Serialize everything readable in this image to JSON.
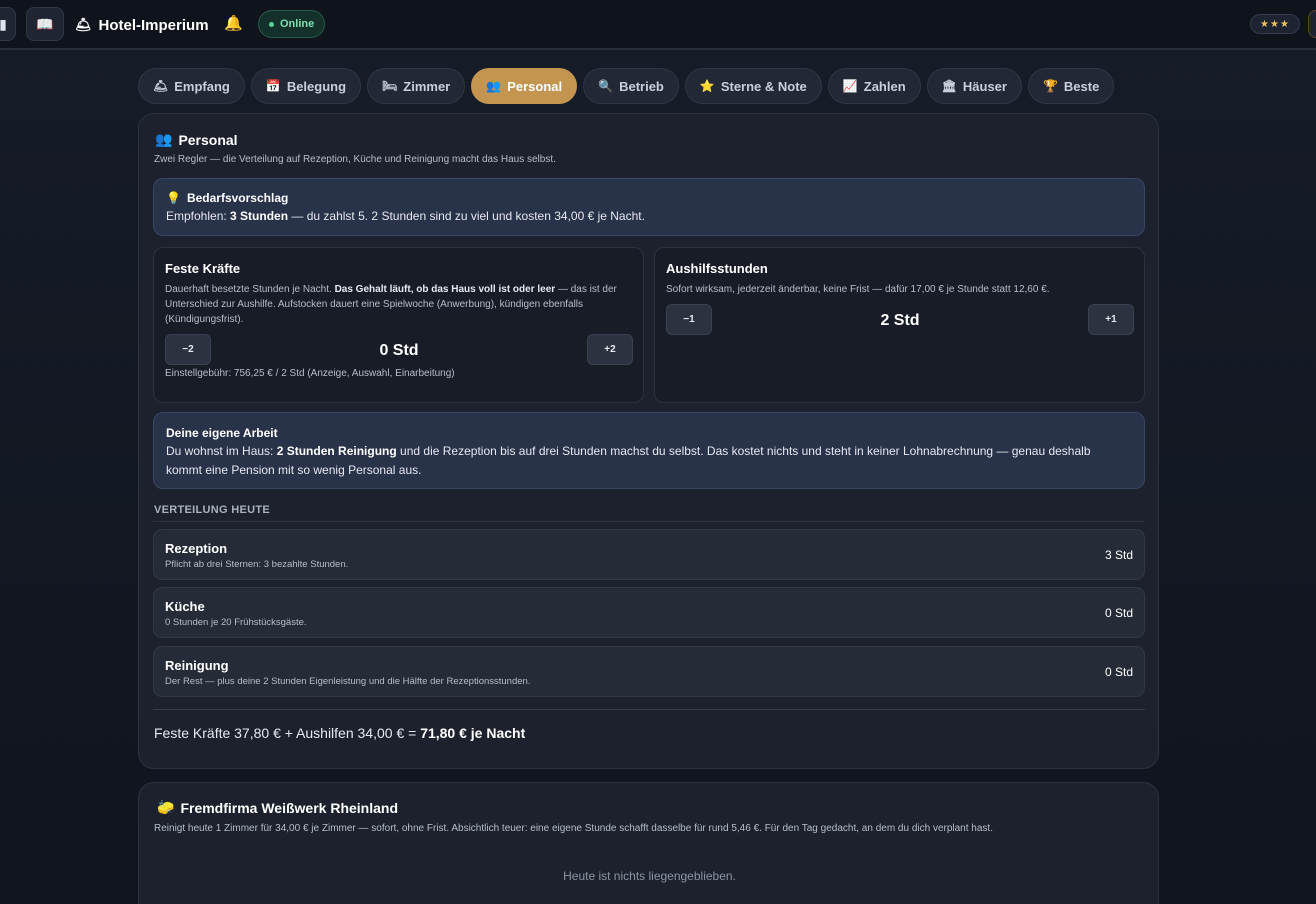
{
  "app": {
    "title": "Hotel-Imperium",
    "status": "Online",
    "stars": "★★★",
    "icons": {
      "brand": "bell-icon",
      "book": "book-icon",
      "ring": "bell-ring-icon"
    }
  },
  "tabs": [
    {
      "icon": "🛎",
      "label": "Empfang",
      "active": false
    },
    {
      "icon": "📅",
      "label": "Belegung",
      "active": false
    },
    {
      "icon": "🛏",
      "label": "Zimmer",
      "active": false
    },
    {
      "icon": "👥",
      "label": "Personal",
      "active": true
    },
    {
      "icon": "🔍",
      "label": "Betrieb",
      "active": false
    },
    {
      "icon": "⭐",
      "label": "Sterne & Note",
      "active": false
    },
    {
      "icon": "📈",
      "label": "Zahlen",
      "active": false
    },
    {
      "icon": "🏛",
      "label": "Häuser",
      "active": false
    },
    {
      "icon": "🏆",
      "label": "Beste",
      "active": false
    }
  ],
  "personal": {
    "icon": "👥",
    "title": "Personal",
    "subtitle": "Zwei Regler — die Verteilung auf Rezeption, Küche und Reinigung macht das Haus selbst.",
    "hint": {
      "icon": "💡",
      "title": "Bedarfsvorschlag",
      "prefix": "Empfohlen: ",
      "strong": "3 Stunden",
      "suffix": " — du zahlst 5. 2 Stunden sind zu viel und kosten 34,00 € je Nacht."
    },
    "fixed": {
      "title": "Feste Kräfte",
      "desc_a": "Dauerhaft besetzte Stunden je Nacht. ",
      "desc_b": "Das Gehalt läuft, ob das Haus voll ist oder leer",
      "desc_c": " — das ist der Unterschied zur Aushilfe. Aufstocken dauert eine Spielwoche (Anwerbung), kündigen ebenfalls (Kündigungsfrist).",
      "minus": "−2",
      "value": "0 Std",
      "plus": "+2",
      "fee": "Einstellgebühr: 756,25 € / 2 Std (Anzeige, Auswahl, Einarbeitung)"
    },
    "temp": {
      "title": "Aushilfsstunden",
      "desc": "Sofort wirksam, jederzeit änderbar, keine Frist — dafür 17,00 € je Stunde statt 12,60 €.",
      "minus": "−1",
      "value": "2 Std",
      "plus": "+1"
    },
    "own": {
      "title": "Deine eigene Arbeit",
      "prefix": "Du wohnst im Haus: ",
      "strong": "2 Stunden Reinigung",
      "suffix": " und die Rezeption bis auf drei Stunden machst du selbst. Das kostet nichts und steht in keiner Lohnabrechnung — genau deshalb kommt eine Pension mit so wenig Personal aus."
    },
    "distribution_heading": "VERTEILUNG HEUTE",
    "rows": [
      {
        "title": "Rezeption",
        "sub": "Pflicht ab drei Sternen: 3 bezahlte Stunden.",
        "value": "3 Std"
      },
      {
        "title": "Küche",
        "sub": "0 Stunden je 20 Frühstücksgäste.",
        "value": "0 Std"
      },
      {
        "title": "Reinigung",
        "sub": "Der Rest — plus deine 2 Stunden Eigenleistung und die Hälfte der Rezeptionsstunden.",
        "value": "0 Std"
      }
    ],
    "total_prefix": "Feste Kräfte 37,80 € + Aushilfen 34,00 € = ",
    "total_strong": "71,80 € je Nacht"
  },
  "company": {
    "icon": "🧽",
    "title": "Fremdfirma Weißwerk Rheinland",
    "subtitle": "Reinigt heute 1 Zimmer für 34,00 € je Zimmer — sofort, ohne Frist. Absichtlich teuer: eine eigene Stunde schafft dasselbe für rund 5,46 €. Für den Tag gedacht, an dem du dich verplant hast.",
    "empty": "Heute ist nichts liegengeblieben."
  }
}
